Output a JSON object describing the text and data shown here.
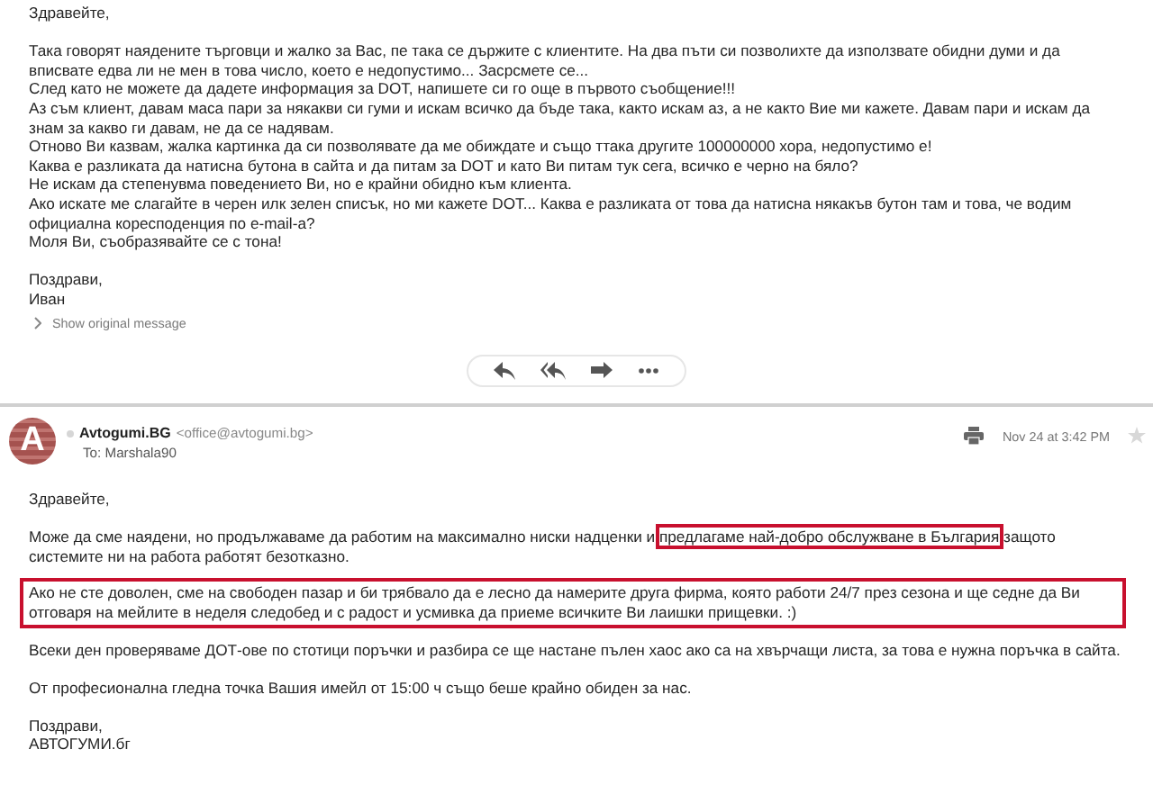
{
  "first_message": {
    "greeting": "Здравейте,",
    "paragraphs": [
      [
        "Така говорят наядените търговци и жалко за Вас, пе така се държите с клиентите. На два пъти си позволихте да използвате обидни думи и да вписвате едва ли не мен в това число, което е недопустимо... Засрсмете се...",
        "След като не можете да дадете информация за DOT, напишете си го още в първото съобщение!!!",
        "Аз съм клиент, давам маса пари за някакви си гуми и искам всичко да бъде така, както искам аз, а не както Вие ми кажете. Давам пари и искам да знам за какво ги давам, не да се надявам.",
        "Отново Ви казвам, жалка картинка да си позволявате да ме обиждате и също ттака другите 100000000 хора, недопустимо е!",
        "Каква е разликата да натисна бутона в сайта и да питам за DOT и като Ви питам тук сега, всичко е черно на бяло?",
        "Не искам да степенувма поведението Ви, но е крайни обидно към клиента.",
        "Ако искате ме слагайте в черен илк зелен списък, но ми кажете DOT... Каква е разликата от това да натисна някакъв бутон там и това, че водим официална коресподенция по e-mail-a?",
        "Моля Ви, съобразявайте се с тона!"
      ]
    ],
    "signoff": [
      "Поздрави,",
      "Иван"
    ],
    "show_original": "Show original message"
  },
  "actions": [
    {
      "kind": "reply"
    },
    {
      "kind": "reply_all"
    },
    {
      "kind": "forward"
    },
    {
      "kind": "more"
    }
  ],
  "second_message": {
    "avatar_letter": "A",
    "sender_name": "Avtogumi.BG",
    "sender_email": "<office@avtogumi.bg>",
    "to": "To: Marshala90",
    "date": "Nov 24 at 3:42 PM",
    "starred": false,
    "greeting": "Здравейте,",
    "paragraphs": [
      {
        "highlighted": false,
        "segments": [
          {
            "text": "Може да сме наядени, но продължаваме да работим на максимално ниски надценки и ",
            "highlighted": false
          },
          {
            "text": "предлагаме най-добро обслужване в България",
            "highlighted": true
          },
          {
            "text": " защото системите ни на работа работят безотказно.",
            "highlighted": false
          }
        ]
      },
      {
        "highlighted": true,
        "segments": [
          {
            "text": "Ако не сте доволен, сме на свободен пазар и би трябвало да е лесно да намерите друга фирма, която работи 24/7 през сезона и ще седне да Ви отговаря на мейлите в неделя следобед и с радост и усмивка да приеме всичките Ви лаишки прищевки. :)",
            "highlighted": false
          }
        ]
      },
      {
        "highlighted": false,
        "segments": [
          {
            "text": "Всеки ден проверяваме ДОТ-ове по стотици поръчки и разбира се ще настане пълен хаос ако са на хвърчащи листа, за това е нужна поръчка в сайта.",
            "highlighted": false
          }
        ]
      },
      {
        "highlighted": false,
        "segments": [
          {
            "text": "От професионална гледна точка Вашия имейл от 15:00 ч също беше крайно обиден за нас.",
            "highlighted": false
          }
        ]
      }
    ],
    "signoff": [
      "Поздрави,",
      "АВТОГУМИ.бг"
    ]
  }
}
